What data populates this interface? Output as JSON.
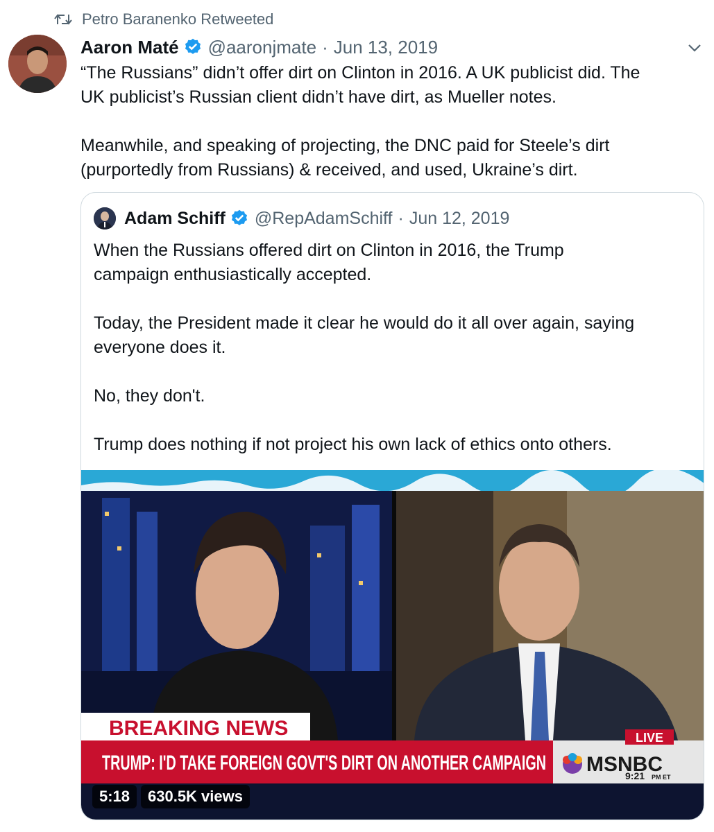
{
  "retweet": {
    "text": "Petro Baranenko Retweeted",
    "icon": "retweet-icon"
  },
  "tweet": {
    "name": "Aaron Maté",
    "handle": "@aaronjmate",
    "separator": "·",
    "date": "Jun 13, 2019",
    "paragraphs": [
      "“The Russians” didn’t offer dirt on Clinton in 2016. A UK publicist did. The",
      "UK publicist’s Russian client didn’t have dirt, as Mueller notes.",
      "Meanwhile, and speaking of projecting, the DNC paid for Steele’s dirt",
      "(purportedly from Russians) & received, and used, Ukraine’s dirt."
    ]
  },
  "quote": {
    "name": "Adam Schiff",
    "handle": "@RepAdamSchiff",
    "separator": "·",
    "date": "Jun 12, 2019",
    "lines": [
      "When the Russians offered dirt on Clinton in 2016, the Trump",
      "campaign enthusiastically accepted.",
      "Today, the President made it clear he would do it all over again, saying",
      "everyone does it.",
      "No, they don't.",
      "Trump does nothing if not project his own lack of ethics onto others."
    ]
  },
  "video": {
    "breaking": "BREAKING NEWS",
    "ticker": "TRUMP: I'D TAKE FOREIGN GOVT'S DIRT ON ANOTHER CAMPAIGN",
    "live": "LIVE",
    "network": "MSNBC",
    "time": "9:21",
    "time_suffix": "PM ET",
    "duration": "5:18",
    "views": "630.5K views"
  },
  "colors": {
    "verified": "#1d9bf0",
    "muted": "#536471",
    "breaking_red": "#c8102e"
  }
}
